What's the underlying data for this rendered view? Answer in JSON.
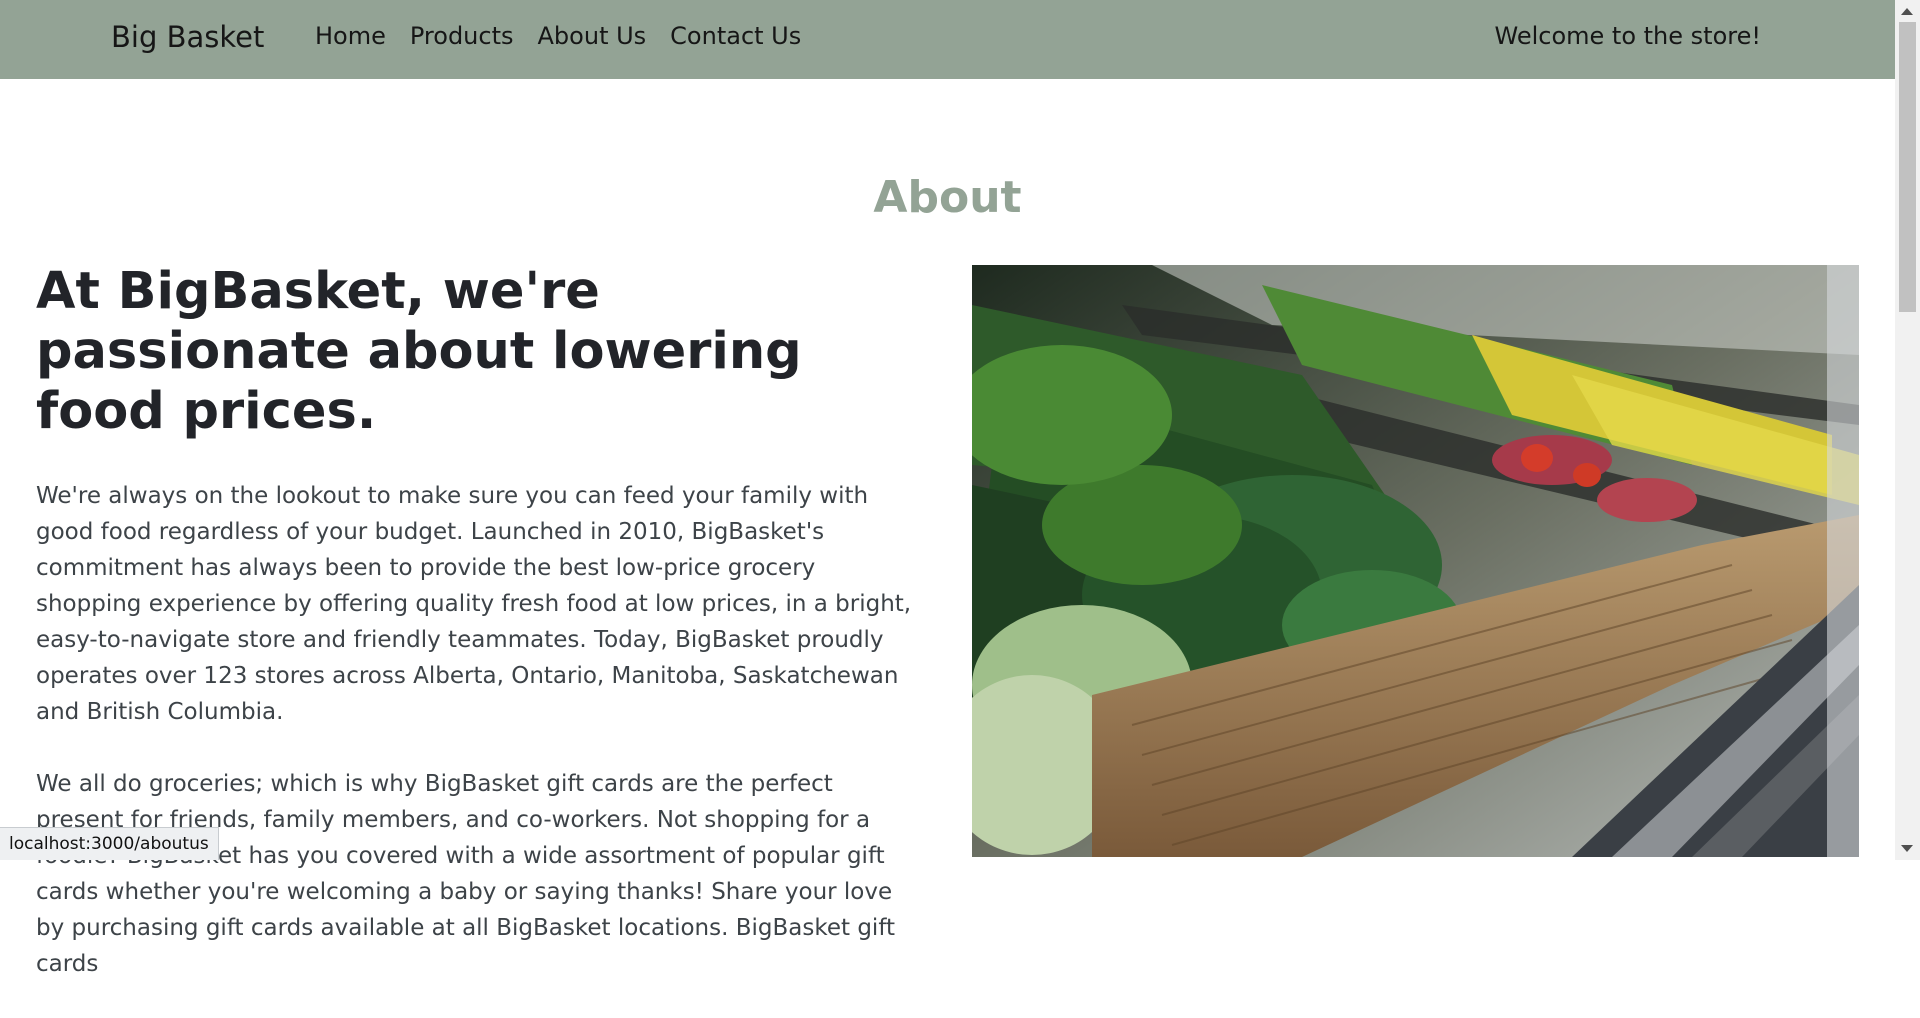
{
  "header": {
    "brand": "Big Basket",
    "nav": [
      "Home",
      "Products",
      "About Us",
      "Contact Us"
    ],
    "welcome": "Welcome to the store!"
  },
  "about": {
    "title": "About",
    "headline": "At BigBasket, we're passionate about lowering food prices.",
    "paragraphs": [
      "We're always on the lookout to make sure you can feed your family with good food regardless of your budget. Launched in 2010, BigBasket's commitment has always been to provide the best low-price grocery shopping experience by offering quality fresh food at low prices, in a bright, easy-to-navigate store and friendly teammates. Today, BigBasket proudly operates over 123 stores across Alberta, Ontario, Manitoba, Saskatchewan and British Columbia.",
      "We all do groceries; which is why BigBasket gift cards are the perfect present for friends, family members, and co-workers. Not shopping for a foodie? BigBasket has you covered with a wide assortment of popular gift cards whether you're welcoming a baby or saying thanks! Share your love by purchasing gift cards available at all BigBasket locations. BigBasket gift cards"
    ]
  },
  "status_bar": {
    "url": "localhost:3000/aboutus"
  },
  "colors": {
    "navbar_bg": "#93a395",
    "title_color": "#93a395",
    "headline_color": "#222429",
    "body_text": "#3d4348"
  }
}
